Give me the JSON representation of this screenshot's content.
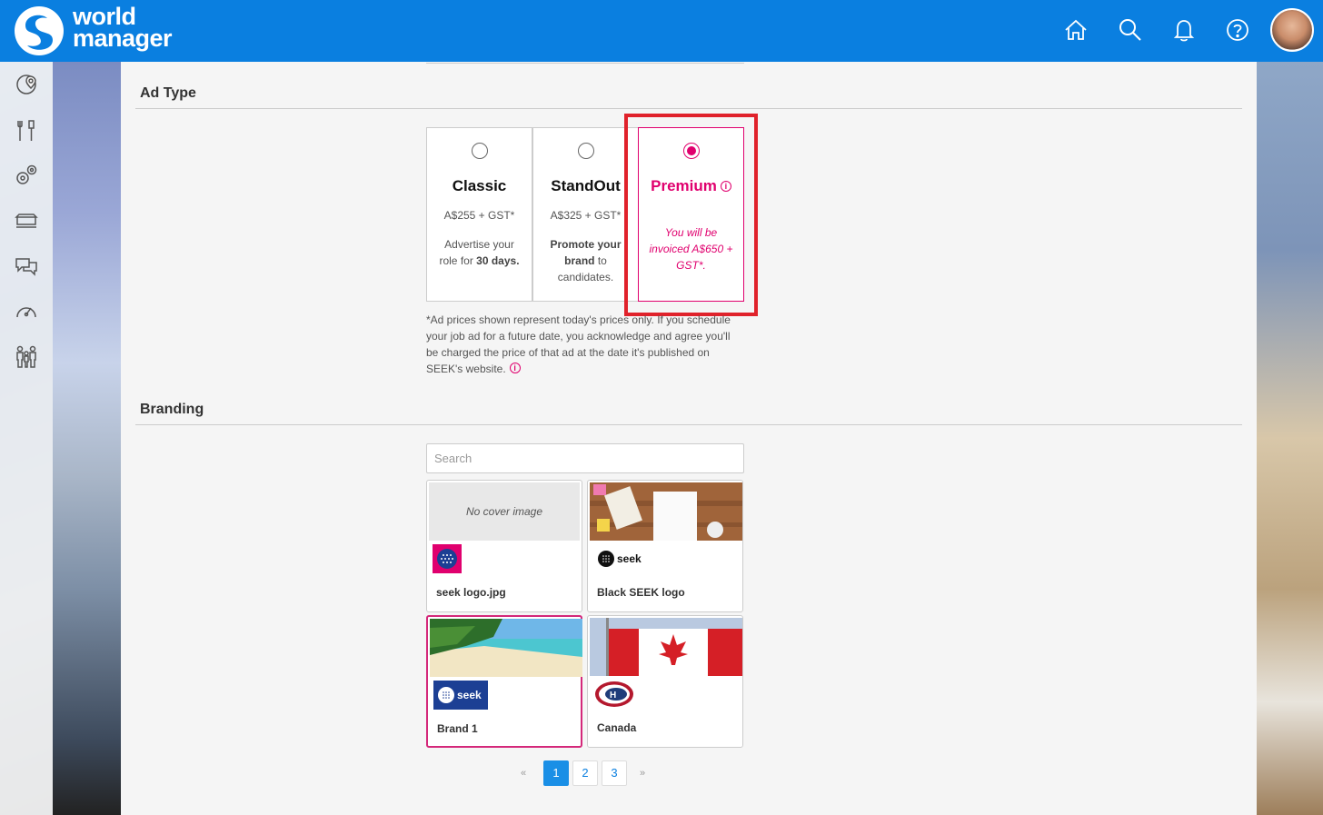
{
  "app": {
    "logo_line1": "world",
    "logo_line2": "manager",
    "brand_color": "#0a7fe0",
    "header_icons": [
      "home-icon",
      "search-icon",
      "bell-icon",
      "help-icon"
    ]
  },
  "sidenav": {
    "icons": [
      "map-pin-icon",
      "tools-icon",
      "gears-icon",
      "truck-icon",
      "chat-icon",
      "speedometer-icon",
      "people-icon"
    ]
  },
  "ad_type": {
    "title": "Ad Type",
    "options": [
      {
        "name": "Classic",
        "price": "A$255 + GST*",
        "desc_pre": "Advertise your role for ",
        "desc_bold": "30 days.",
        "desc_post": "",
        "selected": false
      },
      {
        "name": "StandOut",
        "price": "A$325 + GST*",
        "desc_bold": "Promote your brand",
        "desc_post": " to candidates.",
        "selected": false
      },
      {
        "name": "Premium",
        "invoice": "You will be invoiced A$650 + GST*.",
        "selected": true
      }
    ],
    "note": "*Ad prices shown represent today's prices only. If you schedule your job ad for a future date, you acknowledge and agree you'll be charged the price of that ad at the date it's published on SEEK's website.",
    "accent": "#e0006e",
    "highlight_color": "#e0222b"
  },
  "branding": {
    "title": "Branding",
    "search_placeholder": "Search",
    "no_cover_text": "No cover image",
    "items": [
      {
        "name": "seek logo.jpg",
        "logo_text": "",
        "selected": false
      },
      {
        "name": "Black SEEK logo",
        "logo_text": "seek",
        "selected": false
      },
      {
        "name": "Brand 1",
        "logo_text": "seek",
        "selected": true
      },
      {
        "name": "Canada",
        "logo_text": "",
        "selected": false
      }
    ]
  },
  "pagination": {
    "prev": "«",
    "pages": [
      "1",
      "2",
      "3"
    ],
    "current": "1",
    "next": "»"
  }
}
